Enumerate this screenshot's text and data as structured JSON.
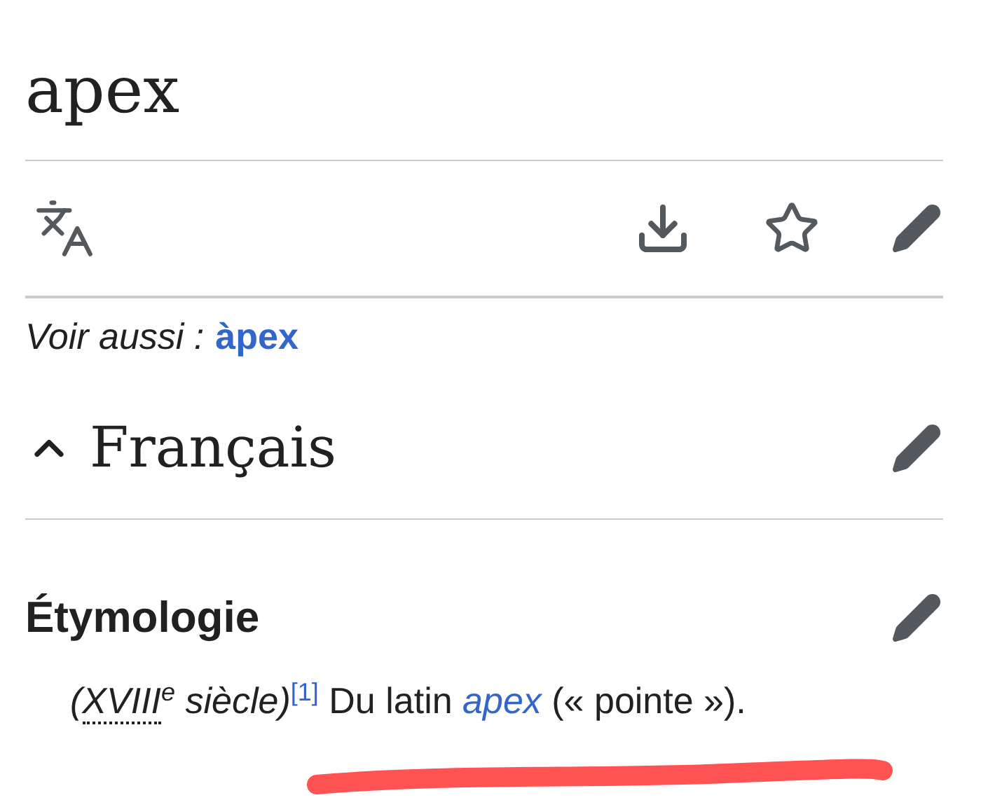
{
  "title": "apex",
  "see_also": {
    "label": "Voir aussi :",
    "link": "àpex"
  },
  "section": {
    "heading": "Français",
    "expanded": true
  },
  "subsection": {
    "heading": "Étymologie"
  },
  "etymology": [
    {
      "kind": "italic",
      "text": "(",
      "abbr": "XVIII",
      "sup": "e",
      "after": " siècle)"
    },
    {
      "kind": "ref",
      "text": "[1]"
    },
    {
      "kind": "text",
      "text": " Du latin "
    },
    {
      "kind": "link",
      "text": "apex"
    },
    {
      "kind": "text",
      "text": " (« pointe »)."
    }
  ]
}
